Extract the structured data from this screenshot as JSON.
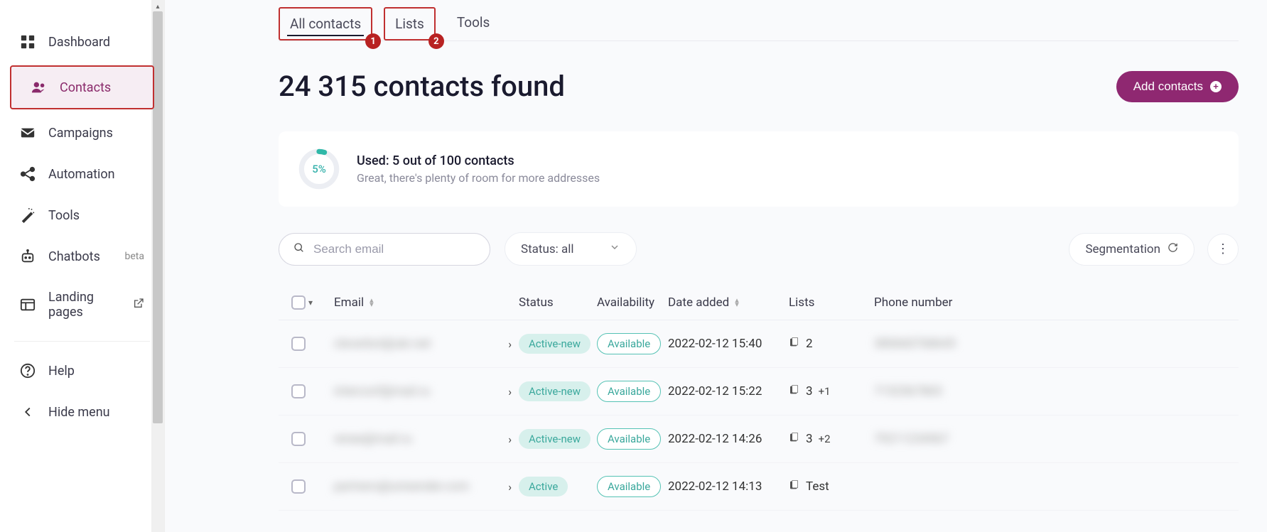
{
  "sidebar": {
    "items": [
      {
        "label": "Dashboard"
      },
      {
        "label": "Contacts"
      },
      {
        "label": "Campaigns"
      },
      {
        "label": "Automation"
      },
      {
        "label": "Tools"
      },
      {
        "label": "Chatbots",
        "badge": "beta"
      },
      {
        "label": "Landing pages"
      }
    ],
    "help_label": "Help",
    "hide_label": "Hide menu"
  },
  "tabs": {
    "all_contacts": "All contacts",
    "lists": "Lists",
    "tools": "Tools",
    "badge1": "1",
    "badge2": "2"
  },
  "page_title": "24 315 contacts found",
  "add_button": "Add contacts",
  "usage": {
    "percent": "5%",
    "line1": "Used: 5 out of 100 contacts",
    "line2": "Great, there's plenty of room for more addresses"
  },
  "toolbar": {
    "search_placeholder": "Search email",
    "status_label": "Status: all",
    "segmentation_label": "Segmentation"
  },
  "table": {
    "headers": {
      "email": "Email",
      "status": "Status",
      "availability": "Availability",
      "date_added": "Date added",
      "lists": "Lists",
      "phone": "Phone number"
    },
    "rows": [
      {
        "email": "cleverbot@ukr.net",
        "status": "Active-new",
        "availability": "Available",
        "date": "2022-02-12 15:40",
        "lists": "2",
        "extra": "",
        "phone": "380660768645"
      },
      {
        "email": "interconf@mail.ru",
        "status": "Active-new",
        "availability": "Available",
        "date": "2022-02-12 15:22",
        "lists": "3",
        "extra": "+1",
        "phone": "7152567865"
      },
      {
        "email": "renee@mail.ru",
        "status": "Active-new",
        "availability": "Available",
        "date": "2022-02-12 14:26",
        "lists": "3",
        "extra": "+2",
        "phone": "79211234567"
      },
      {
        "email": "partners@unisender.com",
        "status": "Active",
        "availability": "Available",
        "date": "2022-02-12 14:13",
        "lists": "Test",
        "extra": "",
        "phone": ""
      }
    ]
  }
}
